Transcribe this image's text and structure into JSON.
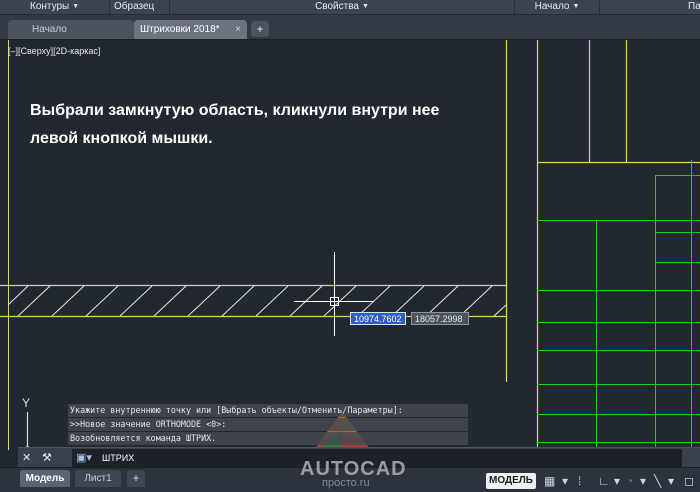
{
  "ribbon": {
    "panels": [
      {
        "label": "Контуры",
        "arrow": true
      },
      {
        "label": "Образец",
        "arrow": false
      },
      {
        "label": "Свойства",
        "arrow": true
      },
      {
        "label": "Начало",
        "arrow": true
      },
      {
        "label": "Пар",
        "arrow": false
      }
    ]
  },
  "file_tabs": [
    {
      "label": "Начало",
      "active": false
    },
    {
      "label": "Штриховки 2018*",
      "active": true
    }
  ],
  "file_tab_close": "×",
  "add_tab": "+",
  "viewport_label": "[–][Сверху][2D-каркас]",
  "caption": "Выбрали замкнутую область, кликнули внутри нее левой кнопкой мышки.",
  "coords": {
    "x": "10974.7602",
    "y": "18057.2998"
  },
  "ucs_y_label": "Y",
  "command_history": [
    "Укажите внутреннюю точку или [Выбрать объекты/Отменить/Параметры]:",
    ">>Новое значение ORTHOMODE <0>:",
    "Возобновляется команда ШТРИХ."
  ],
  "command_input": "ШТРИХ",
  "layout_tabs": {
    "model": "Модель",
    "layout1": "Лист1",
    "add": "+"
  },
  "status": {
    "model_button": "МОДЕЛЬ"
  },
  "watermark": {
    "line1": "AUTOCAD",
    "line2": "просто.ru"
  },
  "colors": {
    "canvas": "#212830",
    "yellow_line": "#d9d96a",
    "green_line": "#1fcc1f",
    "hatch": "#e8e8d8",
    "crosshair": "#ffffff"
  },
  "icons": [
    "close-icon",
    "wrench-icon",
    "command-prompt-icon",
    "grid-icon",
    "snap-icon",
    "ortho-icon",
    "polar-icon"
  ]
}
